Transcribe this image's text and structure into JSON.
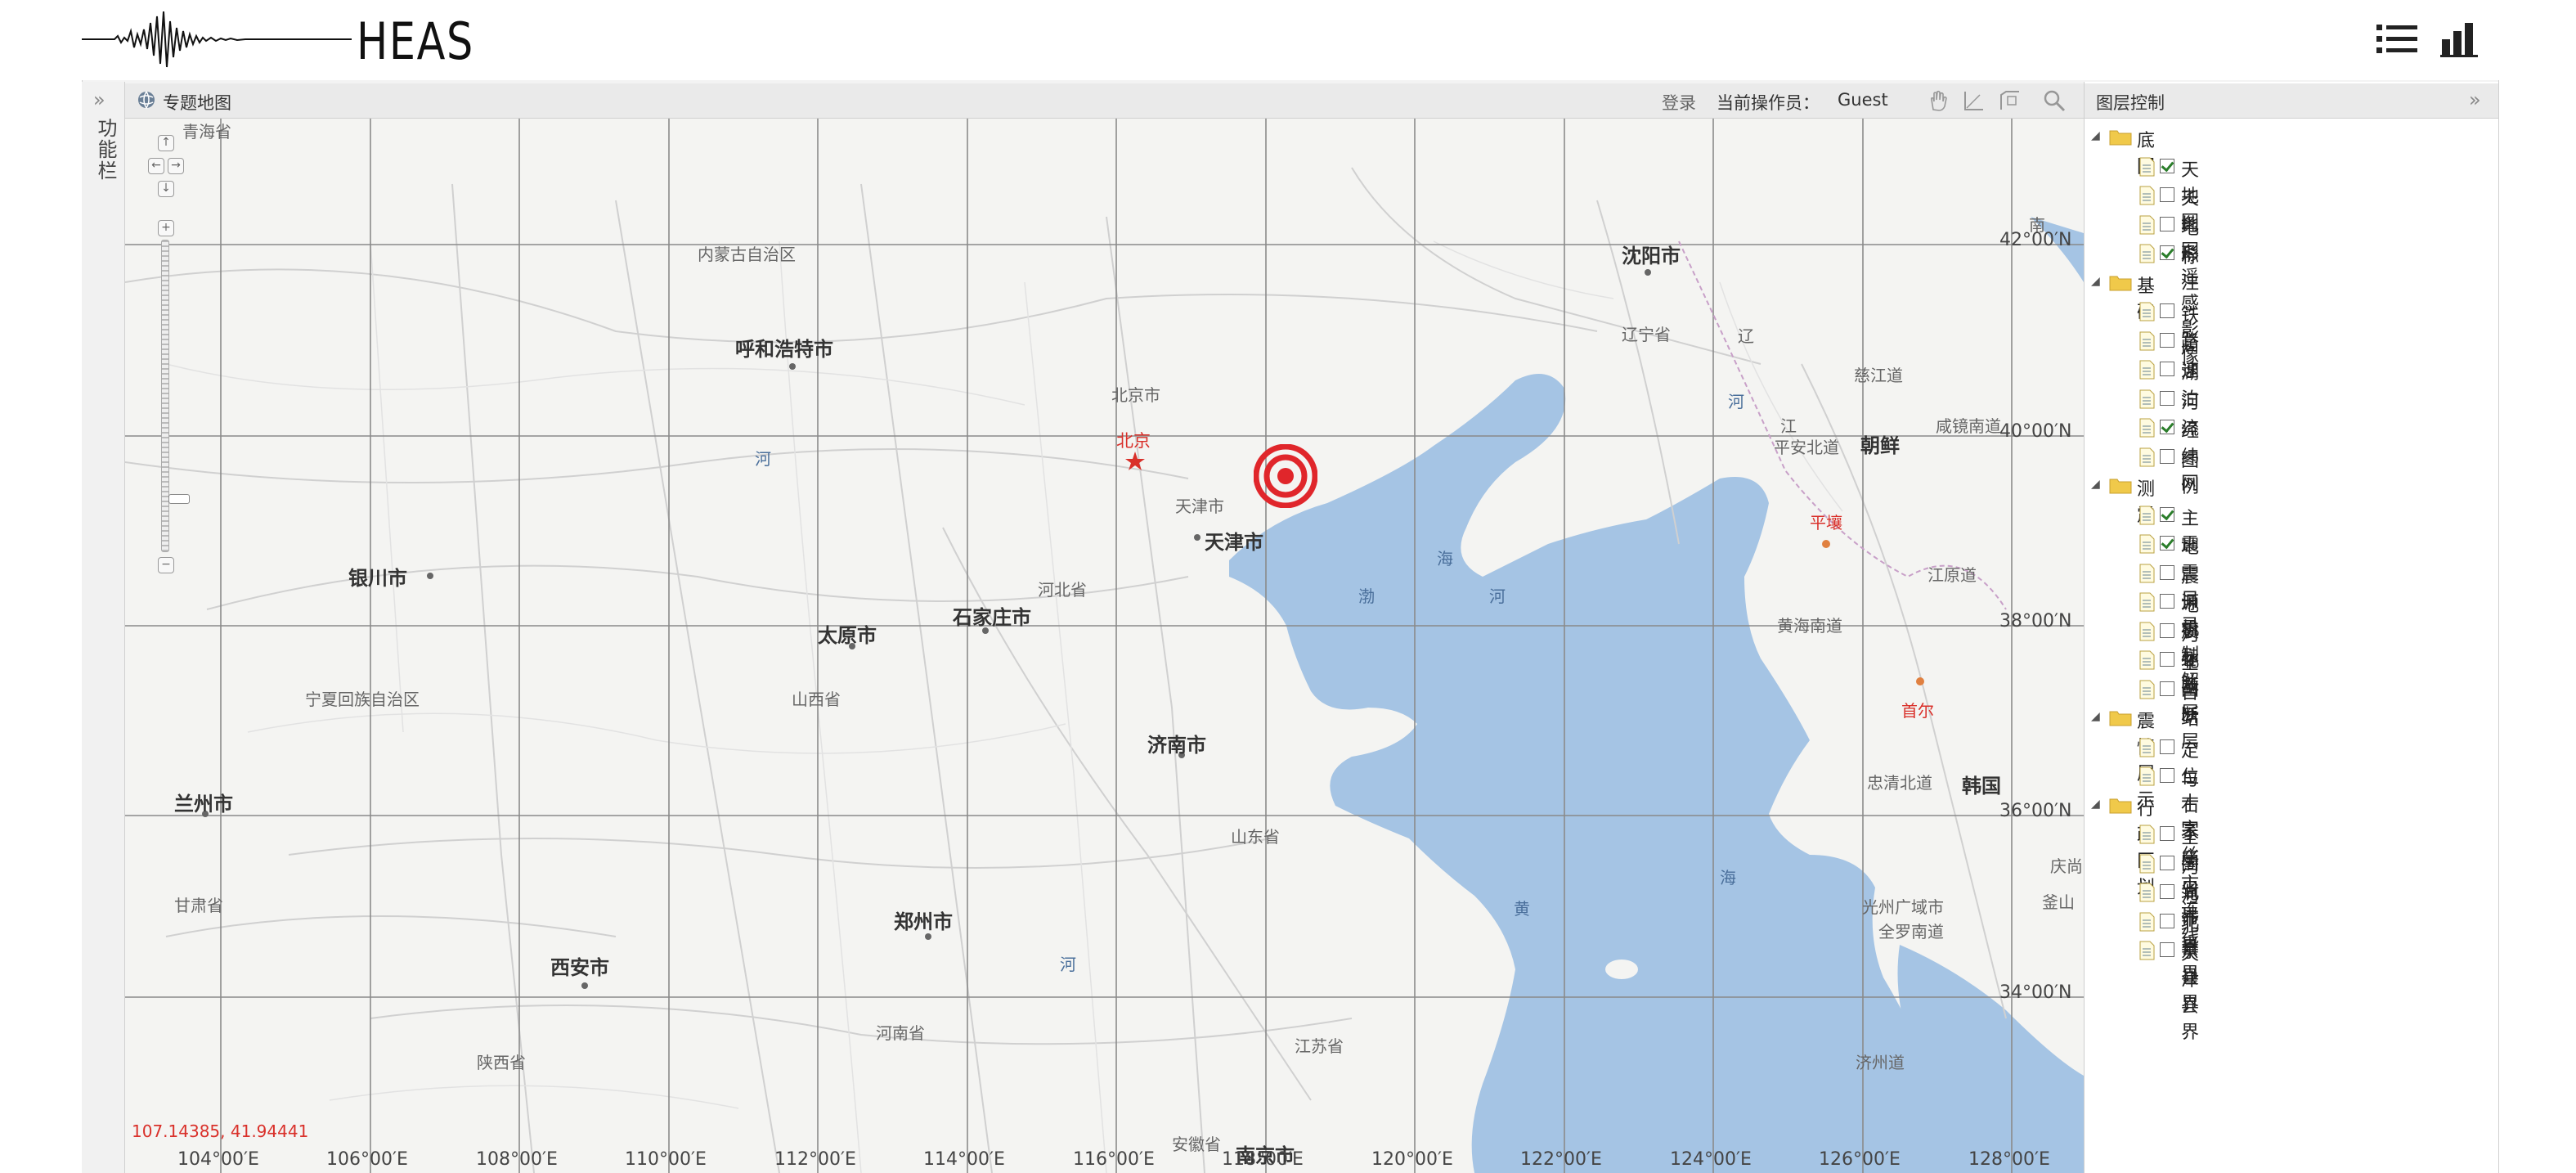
{
  "app": {
    "title": "HEAS"
  },
  "header": {
    "list_icon": "list-icon",
    "chart_icon": "bar-chart-icon"
  },
  "left_tab": {
    "label": "功能栏"
  },
  "toolbar": {
    "title": "专题地图",
    "login": "登录",
    "operator_label": "当前操作员：",
    "operator_user": "Guest",
    "tools": [
      "pan-hand-icon",
      "measure-distance-icon",
      "measure-area-icon",
      "search-icon"
    ]
  },
  "map": {
    "coordinates_readout": "107.14385, 41.94441",
    "latitudes": [
      "42°00′N",
      "40°00′N",
      "38°00′N",
      "36°00′N",
      "34°00′N"
    ],
    "longitudes": [
      "104°00′E",
      "106°00′E",
      "108°00′E",
      "110°00′E",
      "112°00′E",
      "114°00′E",
      "116°00′E",
      "118°00′E",
      "120°00′E",
      "122°00′E",
      "124°00′E",
      "126°00′E",
      "128°00′E"
    ],
    "cities": {
      "hohhot": "呼和浩特市",
      "shenyang": "沈阳市",
      "beijing": "北京",
      "tianjin": "天津市",
      "yinchuan": "银川市",
      "taiyuan": "太原市",
      "shijiazhuang": "石家庄市",
      "jinan": "济南市",
      "lanzhou": "兰州市",
      "zhengzhou": "郑州市",
      "xian": "西安市",
      "nanjing": "南京市",
      "korea_north": "朝鲜",
      "korea_south": "韩国",
      "pyongyang": "平壤",
      "seoul": "首尔"
    },
    "provinces": {
      "neimenggu": "内蒙古自治区",
      "beijingshi": "北京市",
      "liaoning": "辽宁省",
      "tianjin_area": "天津市",
      "hebei": "河北省",
      "ningxia": "宁夏回族自治区",
      "shanxi": "山西省",
      "shandong": "山东省",
      "gansu": "甘肃省",
      "henan": "河南省",
      "shaanxi": "陕西省",
      "jiangsu": "江苏省",
      "anhui": "安徽省",
      "ciganggang": "慈江道",
      "pinganbei": "平安北道",
      "xianjingnan": "咸镜南道",
      "jiangyuan": "江原道",
      "huanghainan": "黄海南道",
      "zhongqingbei": "忠清北道",
      "quanluonan": "全罗南道",
      "guangzhou": "光州广域市",
      "jizhou": "济州道",
      "qingshang": "庆尚",
      "fushan": "釜山",
      "qinghai_top": "青海省",
      "henan_top": "南",
      "liaoning_jiang": "江",
      "liao": "辽"
    },
    "seas": {
      "bo1": "渤",
      "bo2": "海",
      "huang1": "黄",
      "huang2": "海",
      "he1": "河",
      "he2": "河",
      "he3": "河",
      "he4": "河"
    }
  },
  "layer_panel": {
    "title": "图层控制",
    "groups": [
      {
        "label": "底图",
        "items": [
          {
            "label": "天地图",
            "checked": true
          },
          {
            "label": "天地图遥感影像",
            "checked": false
          },
          {
            "label": "地形",
            "checked": false
          },
          {
            "label": "标注",
            "checked": true
          }
        ]
      },
      {
        "label": "基础",
        "items": [
          {
            "label": "铁路",
            "checked": false
          },
          {
            "label": "高速",
            "checked": false
          },
          {
            "label": "湖泊",
            "checked": false
          },
          {
            "label": "河流",
            "checked": false
          },
          {
            "label": "经纬网",
            "checked": true
          },
          {
            "label": "图例",
            "checked": false
          }
        ]
      },
      {
        "label": "测震",
        "items": [
          {
            "label": "主震",
            "checked": true
          },
          {
            "label": "地震目录",
            "checked": true
          },
          {
            "label": "震源机制解",
            "checked": false
          },
          {
            "label": "地震标注",
            "checked": false
          },
          {
            "label": "河北断层",
            "checked": false
          },
          {
            "label": "全国断层",
            "checked": false
          },
          {
            "label": "台站",
            "checked": false
          }
        ]
      },
      {
        "label": "震情展示",
        "items": [
          {
            "label": "定位十字丝",
            "checked": false
          },
          {
            "label": "与石家庄市连线",
            "checked": false
          }
        ]
      },
      {
        "label": "行政区划",
        "items": [
          {
            "label": "全国省界",
            "checked": false
          },
          {
            "label": "河北市界",
            "checked": false
          },
          {
            "label": "河北县界",
            "checked": false
          },
          {
            "label": "北京县界",
            "checked": false
          },
          {
            "label": "天津县界",
            "checked": false
          }
        ]
      }
    ]
  }
}
